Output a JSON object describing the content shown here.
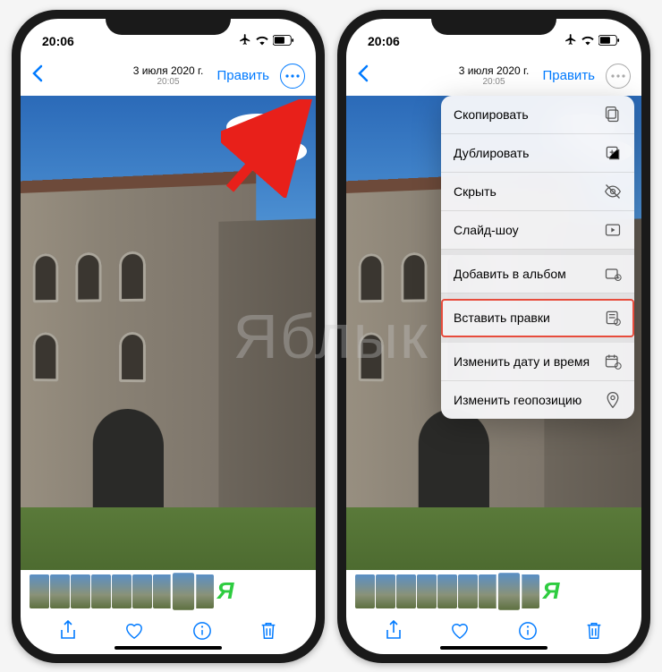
{
  "status": {
    "time": "20:06"
  },
  "nav": {
    "date": "3 июля 2020 г.",
    "time": "20:05",
    "edit": "Править"
  },
  "menu": {
    "copy": "Скопировать",
    "duplicate": "Дублировать",
    "hide": "Скрыть",
    "slideshow": "Слайд-шоу",
    "add_album": "Добавить в альбом",
    "paste_edits": "Вставить правки",
    "change_datetime": "Изменить дату и время",
    "change_location": "Изменить геопозицию"
  },
  "watermark": "Яблык",
  "accent": "#007aff",
  "highlight": "#e74c3c"
}
